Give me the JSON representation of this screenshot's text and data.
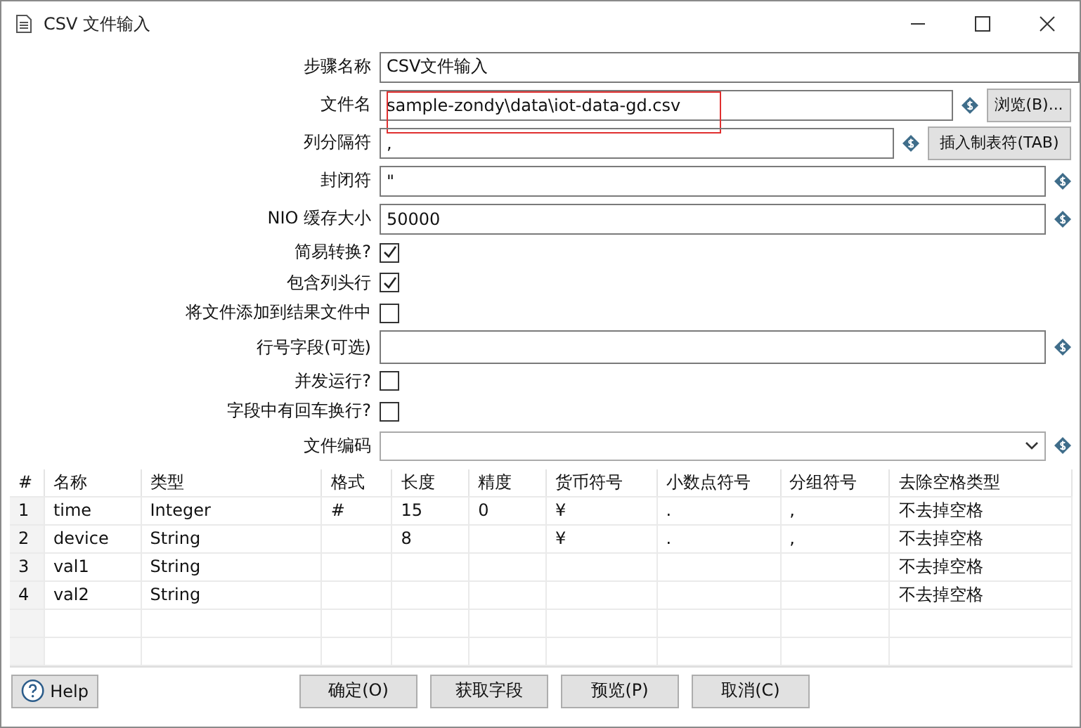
{
  "window": {
    "title": "CSV 文件输入"
  },
  "form": [
    {
      "kind": "text",
      "label": "步骤名称",
      "value": "CSV文件输入"
    },
    {
      "kind": "text",
      "label": "文件名",
      "value": "sample-zondy\\data\\iot-data-gd.csv",
      "variable": true,
      "button": "浏览(B)...",
      "annotated": true
    },
    {
      "kind": "text",
      "label": "列分隔符",
      "value": ",",
      "variable": true,
      "button": "插入制表符(TAB)"
    },
    {
      "kind": "text",
      "label": "封闭符",
      "value": "\"",
      "variable": true
    },
    {
      "kind": "text",
      "label": "NIO 缓存大小",
      "value": "50000",
      "variable": true
    },
    {
      "kind": "checkbox",
      "label": "简易转换?",
      "checked": true
    },
    {
      "kind": "checkbox",
      "label": "包含列头行",
      "checked": true
    },
    {
      "kind": "checkbox",
      "label": "将文件添加到结果文件中",
      "checked": false
    },
    {
      "kind": "text",
      "label": "行号字段(可选)",
      "variable": true
    },
    {
      "kind": "checkbox",
      "label": "并发运行?",
      "checked": false
    },
    {
      "kind": "checkbox",
      "label": "字段中有回车换行?",
      "checked": false
    },
    {
      "kind": "select",
      "label": "文件编码",
      "variable": true
    }
  ],
  "table": {
    "columns": [
      "#",
      "名称",
      "类型",
      "格式",
      "长度",
      "精度",
      "货币符号",
      "小数点符号",
      "分组符号",
      "去除空格类型"
    ],
    "rows": [
      [
        "1",
        "time",
        "Integer",
        "#",
        "15",
        "0",
        "¥",
        ".",
        ",",
        "不去掉空格"
      ],
      [
        "2",
        "device",
        "String",
        "",
        "8",
        "",
        "¥",
        ".",
        ",",
        "不去掉空格"
      ],
      [
        "3",
        "val1",
        "String",
        "",
        "",
        "",
        "",
        "",
        "",
        "不去掉空格"
      ],
      [
        "4",
        "val2",
        "String",
        "",
        "",
        "",
        "",
        "",
        "",
        "不去掉空格"
      ]
    ]
  },
  "help_button": "Help",
  "buttons": [
    "确定(O)",
    "获取字段",
    "预览(P)",
    "取消(C)"
  ]
}
